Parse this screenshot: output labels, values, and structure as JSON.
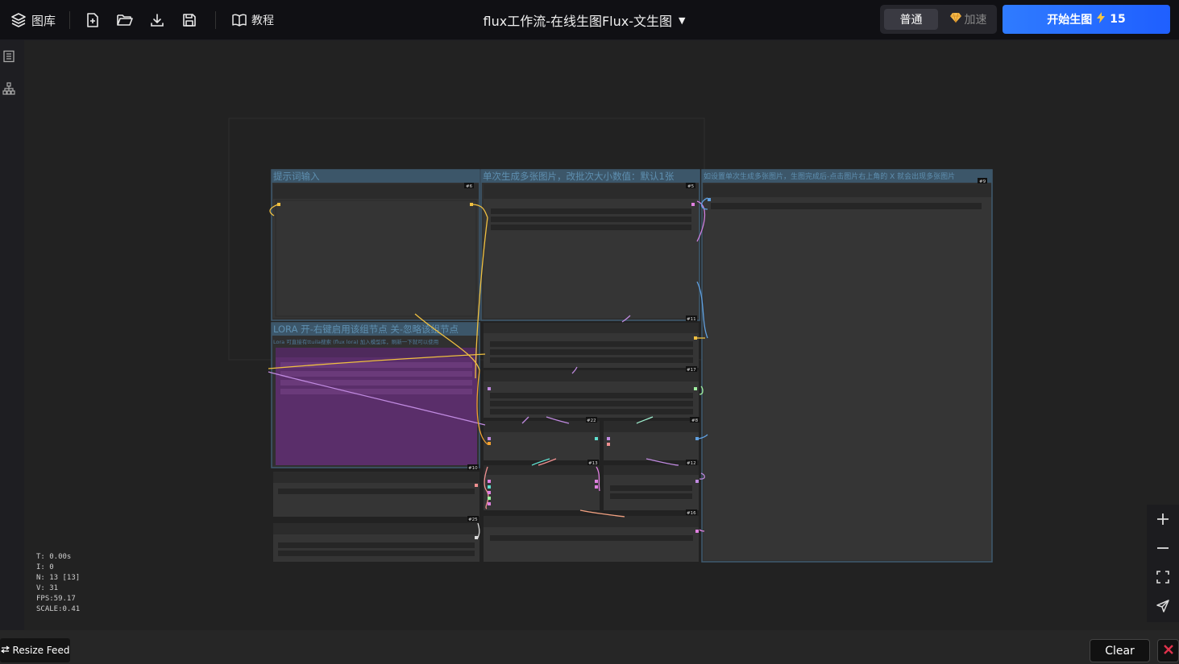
{
  "toolbar": {
    "gallery_label": "图库",
    "tutorial_label": "教程",
    "workflow_title": "flux工作流-在线生图Flux-文生图",
    "mode_normal_label": "普通",
    "mode_fast_label": "加速",
    "start_label": "开始生图",
    "credits": "15"
  },
  "icons": {
    "gallery": "layers-icon",
    "new_file": "file-plus-icon",
    "open": "folder-open-icon",
    "download": "download-icon",
    "save": "save-icon",
    "tutorial": "book-open-icon",
    "dropdown": "caret-down-icon",
    "fast": "diamond-icon",
    "bolt": "lightning-icon",
    "rail_list": "list-icon",
    "rail_tree": "hierarchy-icon",
    "zoom_in": "plus-icon",
    "zoom_out": "minus-icon",
    "fit": "fullscreen-icon",
    "locate": "send-icon",
    "close": "close-icon"
  },
  "colors": {
    "accent": "#2f7bff",
    "group_header": "#3c5669",
    "lora_node": "#5a2e6a",
    "close_red": "#e0324b"
  },
  "groups": [
    {
      "id": "prompt",
      "title": "提示词输入",
      "subtitle": ""
    },
    {
      "id": "batch",
      "title": "单次生成多张图片，改批次大小数值：默认1张",
      "subtitle": ""
    },
    {
      "id": "output",
      "title": "如设置单次生成多张图片，生图完成后-点击图片右上角的 X 就会出现多张图片",
      "subtitle": ""
    },
    {
      "id": "lora",
      "title": "LORA  开-右键启用该组节点  关-忽略该组节点",
      "subtitle": "Lora 可直接有ttuila搜索 (flux lora) 加入模型库，刷新一下就可以使用"
    }
  ],
  "node_badges": [
    "#6",
    "#5",
    "#9",
    "#11",
    "#17",
    "#22",
    "#8",
    "#10",
    "#13",
    "#12",
    "#16",
    "#25"
  ],
  "stats": {
    "t": "T: 0.00s",
    "i": "I: 0",
    "n": "N: 13 [13]",
    "v": "V: 31",
    "fps": "FPS:59.17",
    "scale": "SCALE:0.41"
  },
  "bottom": {
    "resize_label": "Resize Feed",
    "clear_label": "Clear"
  }
}
